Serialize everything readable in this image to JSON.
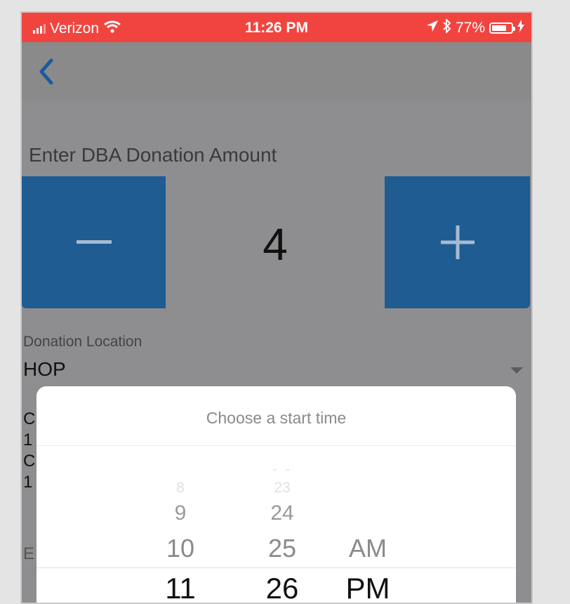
{
  "status_bar": {
    "carrier": "Verizon",
    "time": "11:26 PM",
    "battery_percent_text": "77%",
    "battery_level": 0.77
  },
  "nav": {
    "back_icon": "chevron-left-icon"
  },
  "donation": {
    "title": "Enter DBA Donation Amount",
    "minus_icon": "minus-icon",
    "plus_icon": "plus-icon",
    "amount": "4"
  },
  "location": {
    "label": "Donation Location",
    "value": "HOP"
  },
  "background_fragments": [
    "C",
    "1",
    "C",
    "1",
    "E"
  ],
  "picker": {
    "title": "Choose a start time",
    "hours": [
      "8",
      "9",
      "10",
      "11"
    ],
    "minutes": [
      "23",
      "24",
      "25",
      "26"
    ],
    "ampm": [
      "AM",
      "PM"
    ]
  },
  "colors": {
    "status_bar": "#f2443f",
    "stepper_button": "#1e5c92",
    "back_chevron": "#1a5aa0",
    "overlay_background": "#8e8e91"
  }
}
